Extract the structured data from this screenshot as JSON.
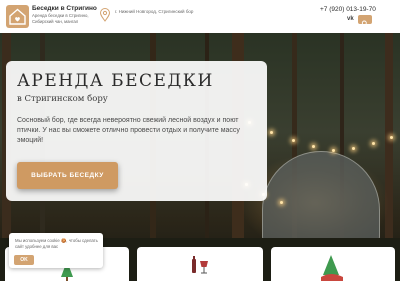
{
  "brand": {
    "title": "Беседки в Стригино",
    "subtitle": "Аренда беседки в Стригино, Сибирский чан, мангал"
  },
  "header": {
    "location": "г. Нижний Новгород, Стригинский бор",
    "phone": "+7 (920) 013-19-70",
    "vk_label": "vk"
  },
  "hero": {
    "title": "АРЕНДА БЕСЕДКИ",
    "subtitle": "в Стригинском бору",
    "description": "Сосновый бор, где всегда невероятно свежий лесной воздух и поют птички. У нас вы сможете отлично провести отдых и получите массу эмоций!",
    "cta_label": "ВЫБРАТЬ БЕСЕДКУ"
  },
  "cookie": {
    "text": "Мы используем cookie 🍪, чтобы сделать сайт удобнее для вас",
    "ok_label": "OK"
  },
  "icons": {
    "logo": "house-heart-icon",
    "location": "map-pin-icon",
    "search": "search-icon",
    "tile_1": "tree-icon",
    "tile_2": "wine-grill-icon",
    "tile_3": "forest-icon"
  },
  "colors": {
    "accent": "#d3a472",
    "cta": "#cf9a62",
    "text_dark": "#2b2b2b"
  }
}
